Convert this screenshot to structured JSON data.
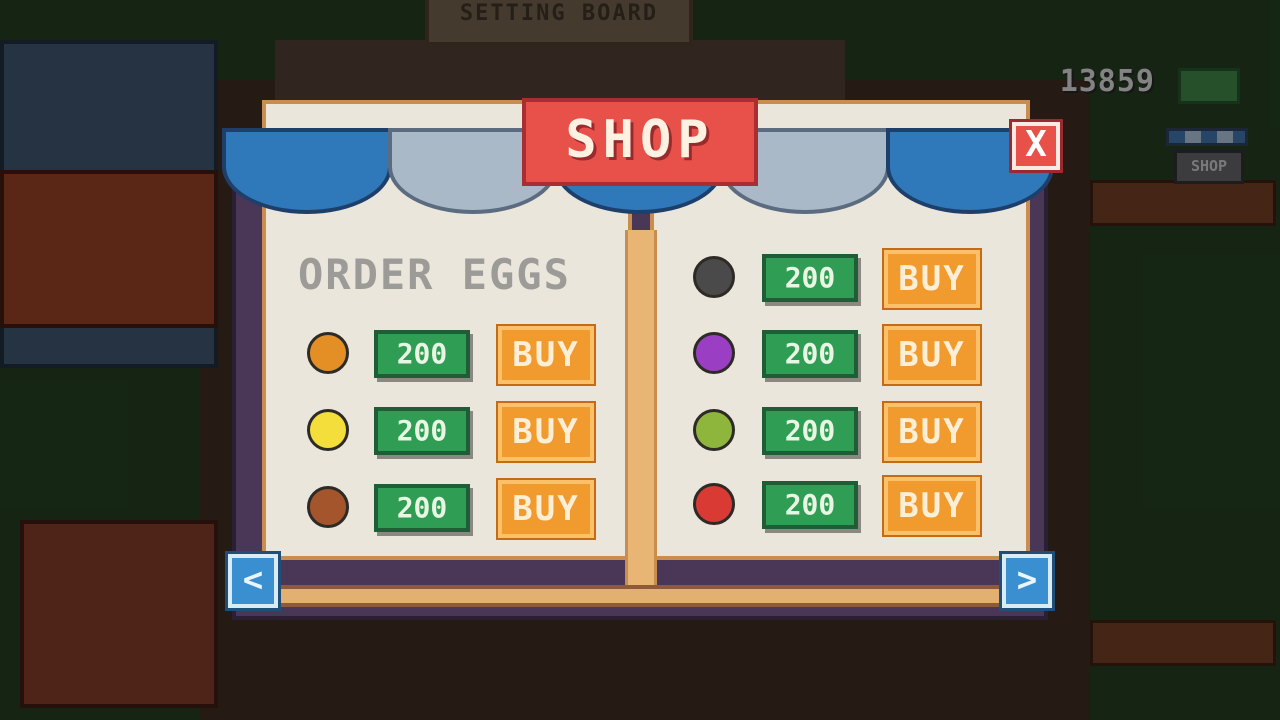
{
  "background": {
    "setting_board_label": "SETTING BOARD",
    "money": "13859",
    "shop_icon_label": "SHOP"
  },
  "shop": {
    "title": "SHOP",
    "close_label": "X",
    "order_title": "ORDER EGGS",
    "prev_label": "<",
    "next_label": ">",
    "left_items": [
      {
        "egg": "orange-egg",
        "color": "#e48f25",
        "price": "200",
        "buy": "BUY"
      },
      {
        "egg": "yellow-egg",
        "color": "#f3de3c",
        "price": "200",
        "buy": "BUY"
      },
      {
        "egg": "brown-egg",
        "color": "#a4552b",
        "price": "200",
        "buy": "BUY"
      }
    ],
    "right_items": [
      {
        "egg": "black-egg",
        "color": "#4a4a4a",
        "price": "200",
        "buy": "BUY"
      },
      {
        "egg": "purple-egg",
        "color": "#9a3fc4",
        "price": "200",
        "buy": "BUY"
      },
      {
        "egg": "green-egg",
        "color": "#8fb63c",
        "price": "200",
        "buy": "BUY"
      },
      {
        "egg": "red-egg",
        "color": "#d93a34",
        "price": "200",
        "buy": "BUY"
      }
    ]
  }
}
